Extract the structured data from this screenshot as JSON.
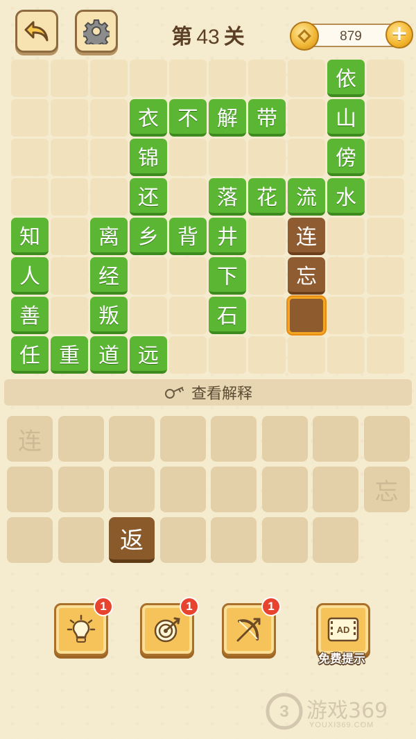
{
  "header": {
    "title_prefix": "第",
    "level_number": "43",
    "title_suffix": "关",
    "coins": "879"
  },
  "board": {
    "tiles": [
      {
        "row": 0,
        "col": 8,
        "char": "依",
        "style": "green"
      },
      {
        "row": 1,
        "col": 3,
        "char": "衣",
        "style": "green"
      },
      {
        "row": 1,
        "col": 4,
        "char": "不",
        "style": "green"
      },
      {
        "row": 1,
        "col": 5,
        "char": "解",
        "style": "green"
      },
      {
        "row": 1,
        "col": 6,
        "char": "带",
        "style": "green"
      },
      {
        "row": 1,
        "col": 8,
        "char": "山",
        "style": "green"
      },
      {
        "row": 2,
        "col": 3,
        "char": "锦",
        "style": "green"
      },
      {
        "row": 2,
        "col": 8,
        "char": "傍",
        "style": "green"
      },
      {
        "row": 3,
        "col": 3,
        "char": "还",
        "style": "green"
      },
      {
        "row": 3,
        "col": 5,
        "char": "落",
        "style": "green"
      },
      {
        "row": 3,
        "col": 6,
        "char": "花",
        "style": "green"
      },
      {
        "row": 3,
        "col": 7,
        "char": "流",
        "style": "green"
      },
      {
        "row": 3,
        "col": 8,
        "char": "水",
        "style": "green"
      },
      {
        "row": 4,
        "col": 0,
        "char": "知",
        "style": "green"
      },
      {
        "row": 4,
        "col": 2,
        "char": "离",
        "style": "green"
      },
      {
        "row": 4,
        "col": 3,
        "char": "乡",
        "style": "green"
      },
      {
        "row": 4,
        "col": 4,
        "char": "背",
        "style": "green"
      },
      {
        "row": 4,
        "col": 5,
        "char": "井",
        "style": "green"
      },
      {
        "row": 4,
        "col": 7,
        "char": "连",
        "style": "brown"
      },
      {
        "row": 5,
        "col": 0,
        "char": "人",
        "style": "green"
      },
      {
        "row": 5,
        "col": 2,
        "char": "经",
        "style": "green"
      },
      {
        "row": 5,
        "col": 5,
        "char": "下",
        "style": "green"
      },
      {
        "row": 5,
        "col": 7,
        "char": "忘",
        "style": "brown"
      },
      {
        "row": 6,
        "col": 0,
        "char": "善",
        "style": "green"
      },
      {
        "row": 6,
        "col": 2,
        "char": "叛",
        "style": "green"
      },
      {
        "row": 6,
        "col": 5,
        "char": "石",
        "style": "green"
      },
      {
        "row": 6,
        "col": 7,
        "char": "",
        "style": "slot"
      },
      {
        "row": 7,
        "col": 0,
        "char": "任",
        "style": "green"
      },
      {
        "row": 7,
        "col": 1,
        "char": "重",
        "style": "green"
      },
      {
        "row": 7,
        "col": 2,
        "char": "道",
        "style": "green"
      },
      {
        "row": 7,
        "col": 3,
        "char": "远",
        "style": "green"
      }
    ]
  },
  "explain": {
    "label": "查看解释"
  },
  "answer_keys": [
    {
      "row": 0,
      "col": 0,
      "char": "连",
      "state": "used"
    },
    {
      "row": 1,
      "col": 7,
      "char": "忘",
      "state": "used"
    },
    {
      "row": 2,
      "col": 2,
      "char": "返",
      "state": "active"
    }
  ],
  "powerups": [
    {
      "icon": "lightbulb-icon",
      "badge": "1"
    },
    {
      "icon": "target-icon",
      "badge": "1"
    },
    {
      "icon": "bow-arrow-icon",
      "badge": "1"
    },
    {
      "icon": "ad-video-icon",
      "label": "免费提示"
    }
  ],
  "watermark": {
    "text": "游戏369",
    "sub": "YOUXI369.COM"
  },
  "colors": {
    "background": "#f5ebcf",
    "tile_green": "#5bb733",
    "tile_brown": "#8f5b30",
    "slot_border": "#f4a623",
    "badge_red": "#e8432f"
  }
}
